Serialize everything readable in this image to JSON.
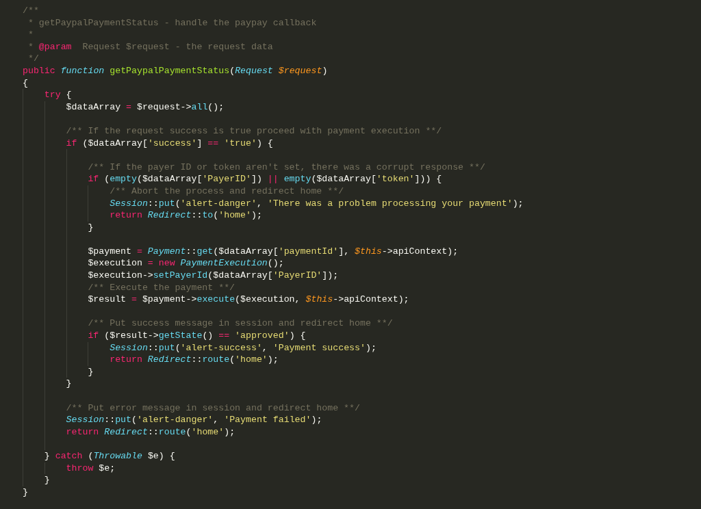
{
  "editor": {
    "code": [
      {
        "kind": "line",
        "tokens": [
          {
            "text": "/**",
            "kind": "comment"
          }
        ]
      },
      {
        "kind": "doc",
        "tokens": [
          {
            "text": "* getPaypalPaymentStatus - handle the paypay callback",
            "kind": "comment"
          }
        ]
      },
      {
        "kind": "doc",
        "tokens": [
          {
            "text": "*",
            "kind": "comment"
          }
        ]
      },
      {
        "kind": "doc",
        "tokens": [
          {
            "text": "* ",
            "kind": "comment"
          },
          {
            "text": "@param",
            "kind": "keyword"
          },
          {
            "text": "  Request $request - the request data",
            "kind": "comment"
          }
        ]
      },
      {
        "kind": "doc",
        "tokens": [
          {
            "text": "*/",
            "kind": "comment"
          }
        ]
      },
      {
        "kind": "line",
        "tokens": [
          {
            "text": "public ",
            "kind": "keyword"
          },
          {
            "text": "function ",
            "kind": "type"
          },
          {
            "text": "getPaypalPaymentStatus",
            "kind": "function"
          },
          {
            "text": "(",
            "kind": "plain"
          },
          {
            "text": "Request ",
            "kind": "type"
          },
          {
            "text": "$request",
            "kind": "param"
          },
          {
            "text": ")",
            "kind": "plain"
          }
        ]
      },
      {
        "kind": "line",
        "tokens": [
          {
            "text": "{",
            "kind": "plain"
          }
        ]
      },
      {
        "kind": "block",
        "children": [
          {
            "kind": "line",
            "tokens": [
              {
                "text": "try",
                "kind": "keyword"
              },
              {
                "text": " {",
                "kind": "plain"
              }
            ]
          },
          {
            "kind": "block",
            "children": [
              {
                "kind": "line",
                "tokens": [
                  {
                    "text": "$dataArray ",
                    "kind": "plain"
                  },
                  {
                    "text": "=",
                    "kind": "keyword"
                  },
                  {
                    "text": " $request->",
                    "kind": "plain"
                  },
                  {
                    "text": "all",
                    "kind": "method"
                  },
                  {
                    "text": "();",
                    "kind": "plain"
                  }
                ]
              },
              {
                "kind": "blank"
              },
              {
                "kind": "line",
                "tokens": [
                  {
                    "text": "/** If the request success is true proceed with payment execution **/",
                    "kind": "comment"
                  }
                ]
              },
              {
                "kind": "line",
                "tokens": [
                  {
                    "text": "if",
                    "kind": "keyword"
                  },
                  {
                    "text": " ($dataArray[",
                    "kind": "plain"
                  },
                  {
                    "text": "'success'",
                    "kind": "string"
                  },
                  {
                    "text": "] ",
                    "kind": "plain"
                  },
                  {
                    "text": "== ",
                    "kind": "keyword"
                  },
                  {
                    "text": "'true'",
                    "kind": "string"
                  },
                  {
                    "text": ") {",
                    "kind": "plain"
                  }
                ]
              },
              {
                "kind": "block",
                "children": [
                  {
                    "kind": "blank"
                  },
                  {
                    "kind": "line",
                    "tokens": [
                      {
                        "text": "/** If the payer ID or token aren't set, there was a corrupt response **/",
                        "kind": "comment"
                      }
                    ]
                  },
                  {
                    "kind": "line",
                    "tokens": [
                      {
                        "text": "if",
                        "kind": "keyword"
                      },
                      {
                        "text": " (",
                        "kind": "plain"
                      },
                      {
                        "text": "empty",
                        "kind": "method"
                      },
                      {
                        "text": "($dataArray[",
                        "kind": "plain"
                      },
                      {
                        "text": "'PayerID'",
                        "kind": "string"
                      },
                      {
                        "text": "]) ",
                        "kind": "plain"
                      },
                      {
                        "text": "|| ",
                        "kind": "keyword"
                      },
                      {
                        "text": "empty",
                        "kind": "method"
                      },
                      {
                        "text": "($dataArray[",
                        "kind": "plain"
                      },
                      {
                        "text": "'token'",
                        "kind": "string"
                      },
                      {
                        "text": "])) {",
                        "kind": "plain"
                      }
                    ]
                  },
                  {
                    "kind": "block",
                    "children": [
                      {
                        "kind": "line",
                        "tokens": [
                          {
                            "text": "/** Abort the process and redirect home **/",
                            "kind": "comment"
                          }
                        ]
                      },
                      {
                        "kind": "line",
                        "tokens": [
                          {
                            "text": "Session",
                            "kind": "type"
                          },
                          {
                            "text": "::",
                            "kind": "plain"
                          },
                          {
                            "text": "put",
                            "kind": "method"
                          },
                          {
                            "text": "(",
                            "kind": "plain"
                          },
                          {
                            "text": "'alert-danger'",
                            "kind": "string"
                          },
                          {
                            "text": ", ",
                            "kind": "plain"
                          },
                          {
                            "text": "'There was a problem processing your payment'",
                            "kind": "string"
                          },
                          {
                            "text": ");",
                            "kind": "plain"
                          }
                        ]
                      },
                      {
                        "kind": "line",
                        "tokens": [
                          {
                            "text": "return ",
                            "kind": "keyword"
                          },
                          {
                            "text": "Redirect",
                            "kind": "type"
                          },
                          {
                            "text": "::",
                            "kind": "plain"
                          },
                          {
                            "text": "to",
                            "kind": "method"
                          },
                          {
                            "text": "(",
                            "kind": "plain"
                          },
                          {
                            "text": "'home'",
                            "kind": "string"
                          },
                          {
                            "text": ");",
                            "kind": "plain"
                          }
                        ]
                      }
                    ]
                  },
                  {
                    "kind": "line",
                    "tokens": [
                      {
                        "text": "}",
                        "kind": "plain"
                      }
                    ]
                  },
                  {
                    "kind": "blank"
                  },
                  {
                    "kind": "line",
                    "tokens": [
                      {
                        "text": "$payment ",
                        "kind": "plain"
                      },
                      {
                        "text": "= ",
                        "kind": "keyword"
                      },
                      {
                        "text": "Payment",
                        "kind": "type"
                      },
                      {
                        "text": "::",
                        "kind": "plain"
                      },
                      {
                        "text": "get",
                        "kind": "method"
                      },
                      {
                        "text": "($dataArray[",
                        "kind": "plain"
                      },
                      {
                        "text": "'paymentId'",
                        "kind": "string"
                      },
                      {
                        "text": "], ",
                        "kind": "plain"
                      },
                      {
                        "text": "$this",
                        "kind": "param"
                      },
                      {
                        "text": "->apiContext);",
                        "kind": "plain"
                      }
                    ]
                  },
                  {
                    "kind": "line",
                    "tokens": [
                      {
                        "text": "$execution ",
                        "kind": "plain"
                      },
                      {
                        "text": "= new ",
                        "kind": "keyword"
                      },
                      {
                        "text": "PaymentExecution",
                        "kind": "type"
                      },
                      {
                        "text": "();",
                        "kind": "plain"
                      }
                    ]
                  },
                  {
                    "kind": "line",
                    "tokens": [
                      {
                        "text": "$execution->",
                        "kind": "plain"
                      },
                      {
                        "text": "setPayerId",
                        "kind": "method"
                      },
                      {
                        "text": "($dataArray[",
                        "kind": "plain"
                      },
                      {
                        "text": "'PayerID'",
                        "kind": "string"
                      },
                      {
                        "text": "]);",
                        "kind": "plain"
                      }
                    ]
                  },
                  {
                    "kind": "line",
                    "tokens": [
                      {
                        "text": "/** Execute the payment **/",
                        "kind": "comment"
                      }
                    ]
                  },
                  {
                    "kind": "line",
                    "tokens": [
                      {
                        "text": "$result ",
                        "kind": "plain"
                      },
                      {
                        "text": "=",
                        "kind": "keyword"
                      },
                      {
                        "text": " $payment->",
                        "kind": "plain"
                      },
                      {
                        "text": "execute",
                        "kind": "method"
                      },
                      {
                        "text": "($execution, ",
                        "kind": "plain"
                      },
                      {
                        "text": "$this",
                        "kind": "param"
                      },
                      {
                        "text": "->apiContext);",
                        "kind": "plain"
                      }
                    ]
                  },
                  {
                    "kind": "blank"
                  },
                  {
                    "kind": "line",
                    "tokens": [
                      {
                        "text": "/** Put success message in session and redirect home **/",
                        "kind": "comment"
                      }
                    ]
                  },
                  {
                    "kind": "line",
                    "tokens": [
                      {
                        "text": "if",
                        "kind": "keyword"
                      },
                      {
                        "text": " ($result->",
                        "kind": "plain"
                      },
                      {
                        "text": "getState",
                        "kind": "method"
                      },
                      {
                        "text": "() ",
                        "kind": "plain"
                      },
                      {
                        "text": "== ",
                        "kind": "keyword"
                      },
                      {
                        "text": "'approved'",
                        "kind": "string"
                      },
                      {
                        "text": ") {",
                        "kind": "plain"
                      }
                    ]
                  },
                  {
                    "kind": "block",
                    "children": [
                      {
                        "kind": "line",
                        "tokens": [
                          {
                            "text": "Session",
                            "kind": "type"
                          },
                          {
                            "text": "::",
                            "kind": "plain"
                          },
                          {
                            "text": "put",
                            "kind": "method"
                          },
                          {
                            "text": "(",
                            "kind": "plain"
                          },
                          {
                            "text": "'alert-success'",
                            "kind": "string"
                          },
                          {
                            "text": ", ",
                            "kind": "plain"
                          },
                          {
                            "text": "'Payment success'",
                            "kind": "string"
                          },
                          {
                            "text": ");",
                            "kind": "plain"
                          }
                        ]
                      },
                      {
                        "kind": "line",
                        "tokens": [
                          {
                            "text": "return ",
                            "kind": "keyword"
                          },
                          {
                            "text": "Redirect",
                            "kind": "type"
                          },
                          {
                            "text": "::",
                            "kind": "plain"
                          },
                          {
                            "text": "route",
                            "kind": "method"
                          },
                          {
                            "text": "(",
                            "kind": "plain"
                          },
                          {
                            "text": "'home'",
                            "kind": "string"
                          },
                          {
                            "text": ");",
                            "kind": "plain"
                          }
                        ]
                      }
                    ]
                  },
                  {
                    "kind": "line",
                    "tokens": [
                      {
                        "text": "}",
                        "kind": "plain"
                      }
                    ]
                  }
                ]
              },
              {
                "kind": "line",
                "tokens": [
                  {
                    "text": "}",
                    "kind": "plain"
                  }
                ]
              },
              {
                "kind": "blank"
              },
              {
                "kind": "line",
                "tokens": [
                  {
                    "text": "/** Put error message in session and redirect home **/",
                    "kind": "comment"
                  }
                ]
              },
              {
                "kind": "line",
                "tokens": [
                  {
                    "text": "Session",
                    "kind": "type"
                  },
                  {
                    "text": "::",
                    "kind": "plain"
                  },
                  {
                    "text": "put",
                    "kind": "method"
                  },
                  {
                    "text": "(",
                    "kind": "plain"
                  },
                  {
                    "text": "'alert-danger'",
                    "kind": "string"
                  },
                  {
                    "text": ", ",
                    "kind": "plain"
                  },
                  {
                    "text": "'Payment failed'",
                    "kind": "string"
                  },
                  {
                    "text": ");",
                    "kind": "plain"
                  }
                ]
              },
              {
                "kind": "line",
                "tokens": [
                  {
                    "text": "return ",
                    "kind": "keyword"
                  },
                  {
                    "text": "Redirect",
                    "kind": "type"
                  },
                  {
                    "text": "::",
                    "kind": "plain"
                  },
                  {
                    "text": "route",
                    "kind": "method"
                  },
                  {
                    "text": "(",
                    "kind": "plain"
                  },
                  {
                    "text": "'home'",
                    "kind": "string"
                  },
                  {
                    "text": ");",
                    "kind": "plain"
                  }
                ]
              },
              {
                "kind": "blank"
              }
            ]
          },
          {
            "kind": "line",
            "tokens": [
              {
                "text": "} ",
                "kind": "plain"
              },
              {
                "text": "catch",
                "kind": "keyword"
              },
              {
                "text": " (",
                "kind": "plain"
              },
              {
                "text": "Throwable",
                "kind": "type"
              },
              {
                "text": " $e) {",
                "kind": "plain"
              }
            ]
          },
          {
            "kind": "block",
            "children": [
              {
                "kind": "line",
                "tokens": [
                  {
                    "text": "throw",
                    "kind": "keyword"
                  },
                  {
                    "text": " $e;",
                    "kind": "plain"
                  }
                ]
              }
            ]
          },
          {
            "kind": "line",
            "tokens": [
              {
                "text": "}",
                "kind": "plain"
              }
            ]
          }
        ]
      },
      {
        "kind": "line",
        "tokens": [
          {
            "text": "}",
            "kind": "plain"
          }
        ]
      }
    ]
  }
}
